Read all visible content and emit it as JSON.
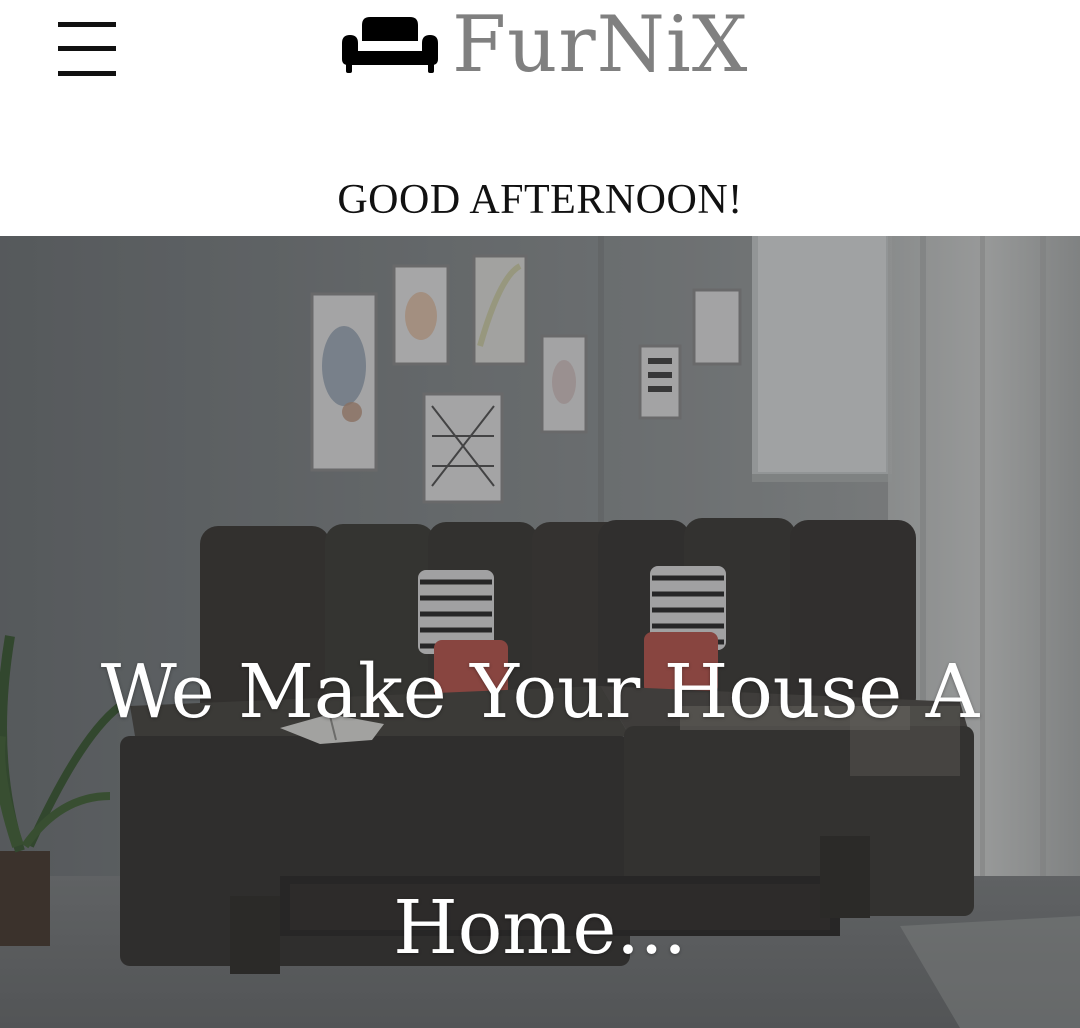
{
  "header": {
    "brand_name": "FurNiX",
    "brand_icon": "sofa-icon",
    "menu_icon": "hamburger-menu-icon",
    "greeting": "GOOD AFTERNOON!"
  },
  "hero": {
    "headline": "We Make Your House A Home...",
    "background": "living-room-sofa-photo"
  },
  "colors": {
    "brand_text": "#808080",
    "greeting_text": "#111111",
    "headline_text": "#ffffff"
  }
}
